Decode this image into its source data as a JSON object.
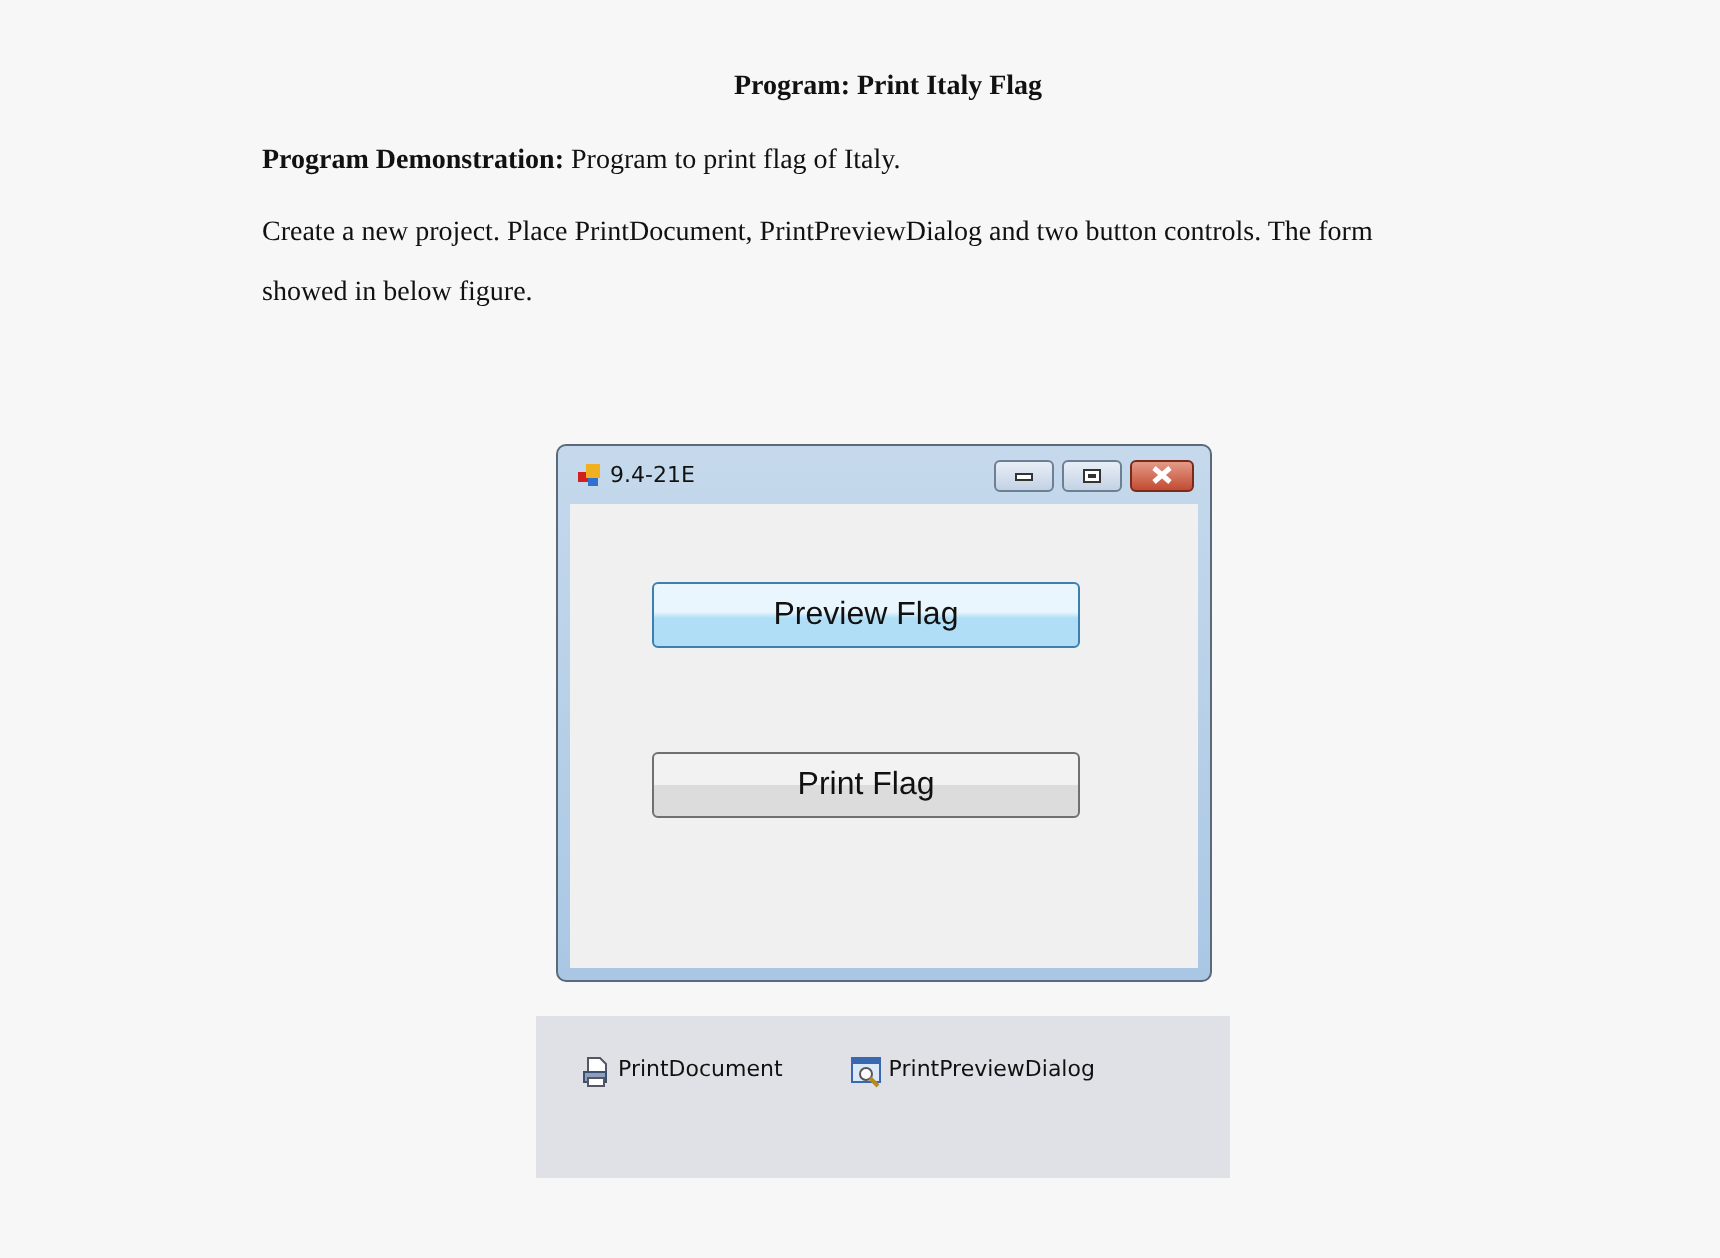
{
  "heading": "Program: Print Italy Flag",
  "paragraphs": [
    "**Program Demonstration:** Program to print flag of Italy.",
    "Create a new project. Place PrintDocument, PrintPreviewDialog and two button controls. The form showed in below figure."
  ],
  "window": {
    "title": "9.4-21E"
  },
  "buttons": [
    {
      "label": "Preview Flag",
      "focused": true
    },
    {
      "label": "Print Flag",
      "focused": false
    }
  ],
  "component_tray": [
    {
      "label": "PrintDocument",
      "kind": "document"
    },
    {
      "label": "PrintPreviewDialog",
      "kind": "preview"
    }
  ]
}
